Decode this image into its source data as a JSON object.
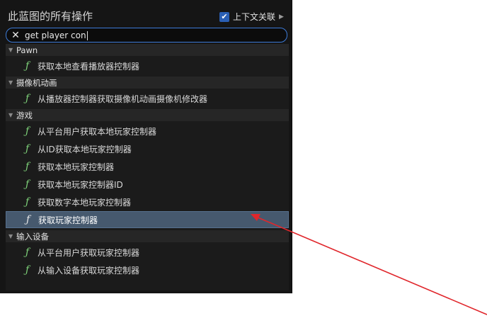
{
  "header": {
    "title": "此蓝图的所有操作",
    "context_label": "上下文关联",
    "context_checked": true,
    "check_glyph": "✔",
    "arrow_glyph": "▶"
  },
  "search": {
    "value": "get player con",
    "clear_glyph": "✕"
  },
  "glyphs": {
    "function": "ƒ",
    "collapse": "▼"
  },
  "categories": [
    {
      "label": "Pawn",
      "items": [
        "获取本地查看播放器控制器"
      ]
    },
    {
      "label": "摄像机动画",
      "items": [
        "从播放器控制器获取摄像机动画摄像机修改器"
      ]
    },
    {
      "label": "游戏",
      "items": [
        "从平台用户获取本地玩家控制器",
        "从ID获取本地玩家控制器",
        "获取本地玩家控制器",
        "获取本地玩家控制器ID",
        "获取数字本地玩家控制器",
        "获取玩家控制器"
      ]
    },
    {
      "label": "输入设备",
      "items": [
        "从平台用户获取玩家控制器",
        "从输入设备获取玩家控制器"
      ]
    }
  ],
  "selected_item": "获取玩家控制器",
  "annotation": {
    "color": "#e0262b"
  }
}
